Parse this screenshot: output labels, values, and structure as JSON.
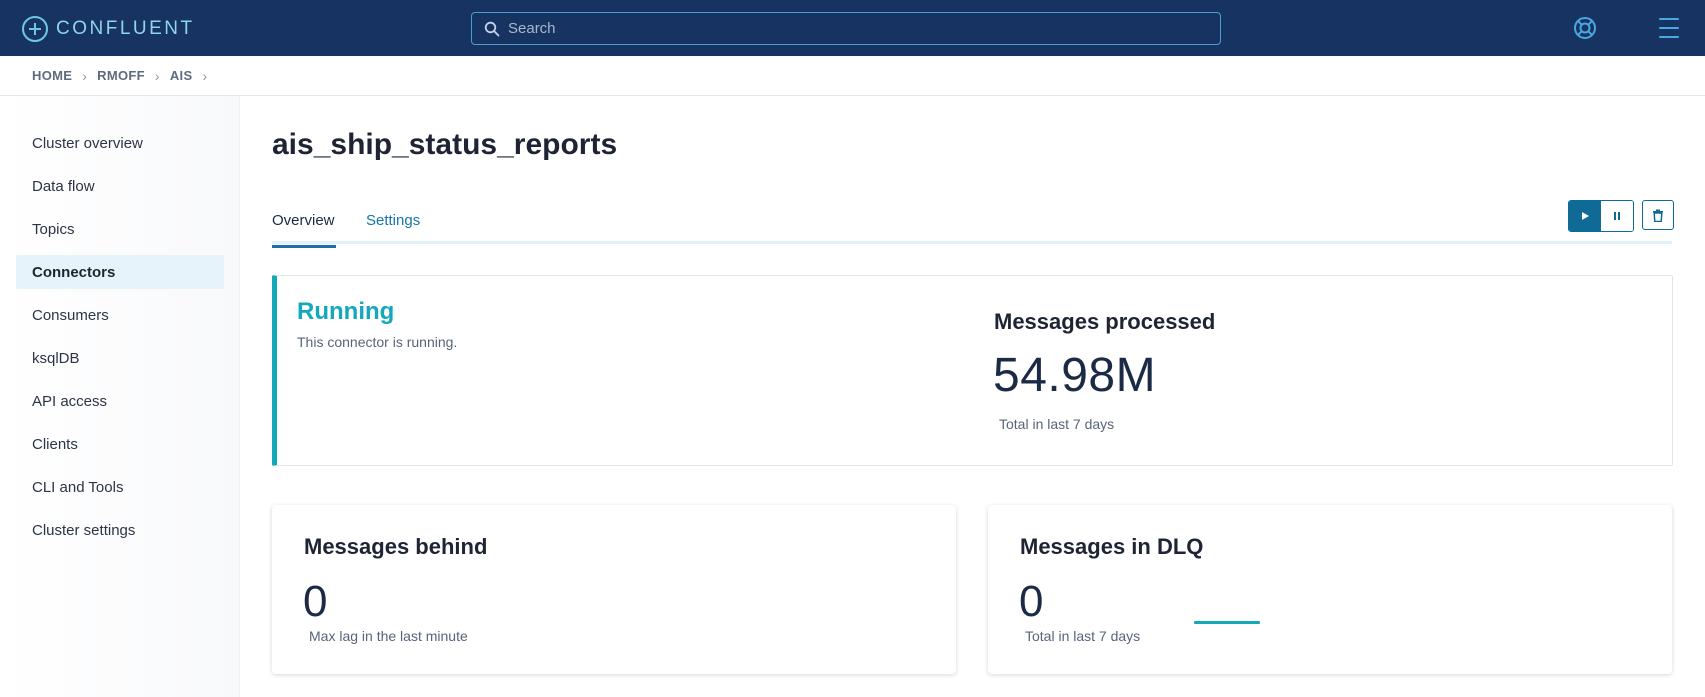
{
  "app": {
    "logo_text": "CONFLUENT",
    "search_placeholder": "Search",
    "accent_color": "#14a8bb",
    "navbar_color": "#173361"
  },
  "breadcrumb": {
    "items": [
      "HOME",
      "RMOFF",
      "AIS"
    ],
    "separator": "›"
  },
  "sidebar": {
    "items": [
      {
        "label": "Cluster overview"
      },
      {
        "label": "Data flow"
      },
      {
        "label": "Topics"
      },
      {
        "label": "Connectors",
        "active": true
      },
      {
        "label": "Consumers"
      },
      {
        "label": "ksqlDB"
      },
      {
        "label": "API access"
      },
      {
        "label": "Clients"
      },
      {
        "label": "CLI and Tools"
      },
      {
        "label": "Cluster settings"
      }
    ]
  },
  "page": {
    "title": "ais_ship_status_reports",
    "tabs": [
      {
        "label": "Overview",
        "active": true
      },
      {
        "label": "Settings"
      }
    ],
    "actions": [
      "play-icon",
      "pause-icon",
      "trash-icon"
    ]
  },
  "status": {
    "title": "Running",
    "description": "This connector is running."
  },
  "messages_processed": {
    "title": "Messages processed",
    "value": "54.98M",
    "subtitle": "Total in last 7 days"
  },
  "messages_behind": {
    "title": "Messages behind",
    "value": "0",
    "subtitle": "Max lag in the last minute"
  },
  "messages_dlq": {
    "title": "Messages in DLQ",
    "value": "0",
    "subtitle": "Total in last 7 days"
  }
}
